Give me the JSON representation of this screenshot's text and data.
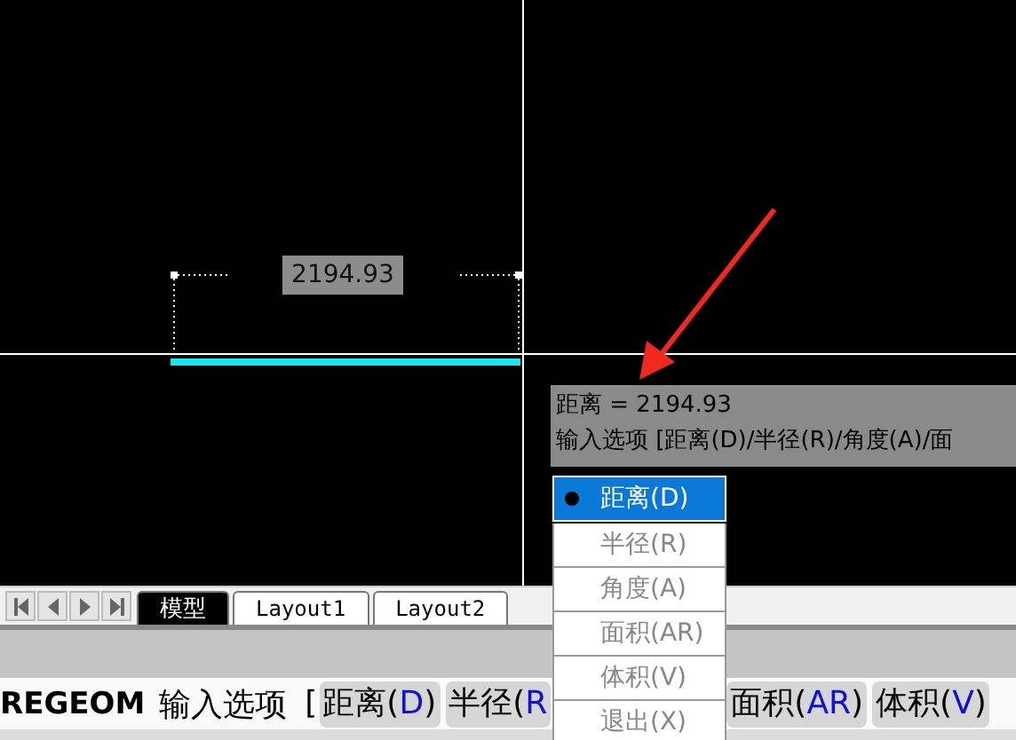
{
  "canvas": {
    "dimension_label": "2194.93"
  },
  "tooltip": {
    "lines": [
      "距离 = 2194.93",
      "输入选项 [距离(D)/半径(R)/角度(A)/面"
    ]
  },
  "option_menu": [
    {
      "label": "距离(D)",
      "selected": true
    },
    {
      "label": "半径(R)",
      "selected": false
    },
    {
      "label": "角度(A)",
      "selected": false
    },
    {
      "label": "面积(AR)",
      "selected": false
    },
    {
      "label": "体积(V)",
      "selected": false
    },
    {
      "label": "退出(X)",
      "selected": false
    }
  ],
  "layout_tabs": [
    {
      "label": "模型",
      "selected": true
    },
    {
      "label": "Layout1",
      "selected": false
    },
    {
      "label": "Layout2",
      "selected": false
    }
  ],
  "command_line": {
    "command": "REGEOM",
    "prompt": "输入选项",
    "bracket": "[",
    "options": [
      {
        "prefix": "距离(",
        "key": "D",
        "suffix": ")"
      },
      {
        "prefix": "半径(",
        "key": "R"
      },
      {
        "prefix": "面积(",
        "key": "AR",
        "suffix": ")"
      },
      {
        "prefix": "体积(",
        "key": "V",
        "suffix": ")"
      }
    ]
  }
}
